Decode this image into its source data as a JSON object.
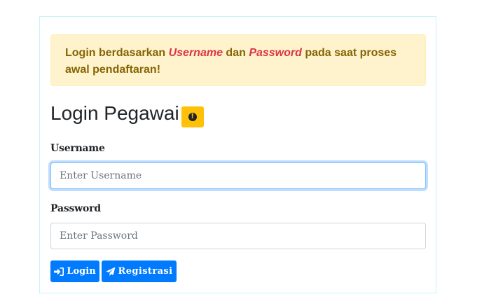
{
  "alert": {
    "part1": "Login berdasarkan ",
    "username_em": "Username",
    "part2": " dan ",
    "password_em": "Password",
    "part3": " pada saat proses awal pendaftaran!"
  },
  "page": {
    "title": "Login Pegawai",
    "info_icon": "exclamation-circle-icon"
  },
  "form": {
    "username_label": "Username",
    "username_placeholder": "Enter Username",
    "username_value": "",
    "password_label": "Password",
    "password_placeholder": "Enter Password",
    "password_value": ""
  },
  "buttons": {
    "login_label": "Login",
    "login_icon": "sign-in-icon",
    "register_label": "Registrasi",
    "register_icon": "paper-plane-icon"
  },
  "colors": {
    "primary": "#007bff",
    "warning": "#ffc107",
    "alert_bg": "#fff3cd",
    "alert_text": "#856404",
    "emphasis": "#dc3545"
  }
}
